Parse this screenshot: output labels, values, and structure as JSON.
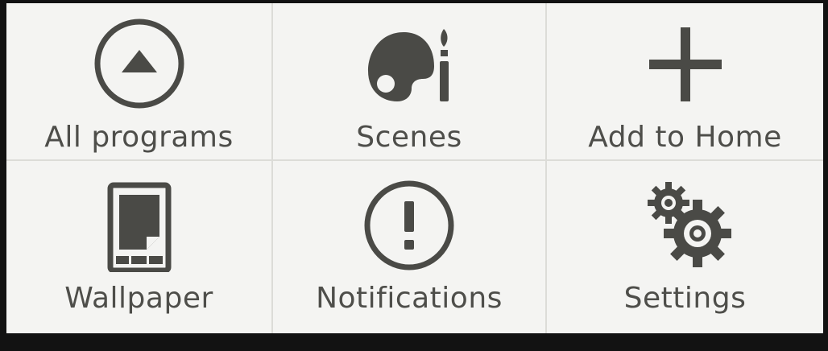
{
  "menu": {
    "items": [
      {
        "label": "All programs",
        "icon": "up-arrow-circle-icon"
      },
      {
        "label": "Scenes",
        "icon": "palette-icon"
      },
      {
        "label": "Add to Home",
        "icon": "plus-icon"
      },
      {
        "label": "Wallpaper",
        "icon": "wallpaper-icon"
      },
      {
        "label": "Notifications",
        "icon": "exclamation-circle-icon"
      },
      {
        "label": "Settings",
        "icon": "gears-icon"
      }
    ]
  },
  "colors": {
    "background": "#f4f4f2",
    "icon": "#4a4a46",
    "text": "#4e4e4a",
    "divider": "#dcdcd8",
    "frame": "#121212"
  }
}
